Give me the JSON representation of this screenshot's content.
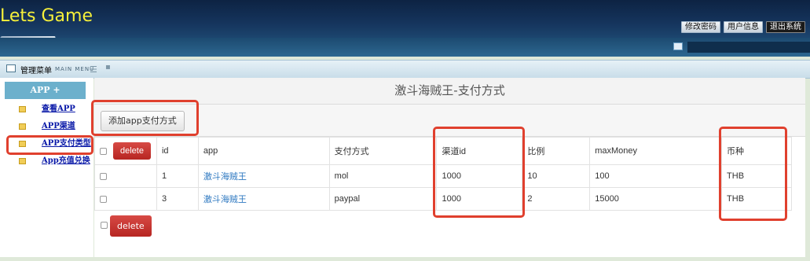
{
  "header": {
    "logo": "Lets Game",
    "links": [
      "修改密码",
      "用户信息",
      "退出系统"
    ]
  },
  "menubar": {
    "title": "管理菜单",
    "subtitle": "MAIN MENU"
  },
  "sidebar": {
    "heading": "APP +",
    "items": [
      {
        "label": "查看APP"
      },
      {
        "label": "APP渠道"
      },
      {
        "label": "APP支付类型"
      },
      {
        "label": "App充值兑换"
      }
    ]
  },
  "content": {
    "title": "激斗海贼王-支付方式",
    "add_button": "添加app支付方式",
    "delete_label": "delete",
    "columns": [
      "id",
      "app",
      "支付方式",
      "渠道id",
      "比例",
      "maxMoney",
      "币种"
    ],
    "rows": [
      {
        "id": "1",
        "app": "激斗海贼王",
        "pay": "mol",
        "channel": "1000",
        "ratio": "10",
        "max": "100",
        "currency": "THB"
      },
      {
        "id": "3",
        "app": "激斗海贼王",
        "pay": "paypal",
        "channel": "1000",
        "ratio": "2",
        "max": "15000",
        "currency": "THB"
      }
    ]
  },
  "colors": {
    "highlight": "#e0402e",
    "logo": "#f6f03a",
    "delete": "#c9302c",
    "sidebar_head": "#6cb0cc",
    "link": "#2f79c1"
  }
}
